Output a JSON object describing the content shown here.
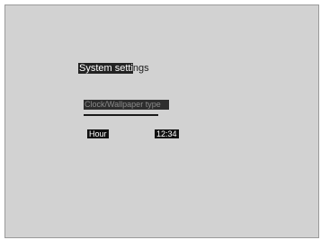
{
  "screen": {
    "title_highlighted": "System setti",
    "title_rest": "ngs",
    "menu_item": "Clock/Wallpaper type",
    "hour_label": "Hour",
    "time_value": "12:34"
  }
}
